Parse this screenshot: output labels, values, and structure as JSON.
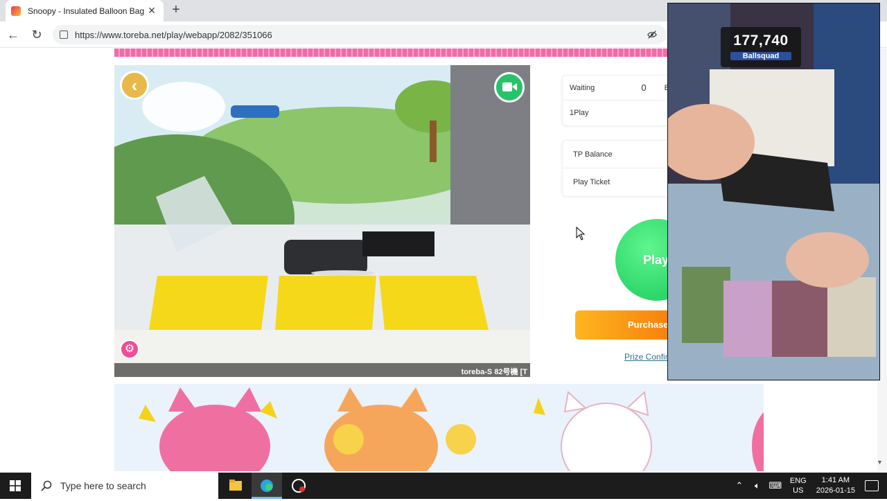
{
  "browser": {
    "tab_title": "Snoopy - Insulated Balloon Bag S",
    "url": "https://www.toreba.net/play/webapp/2082/351066"
  },
  "stream": {
    "machine_label": "toreba-S 82号機 [T"
  },
  "panel": {
    "waiting_label": "Waiting",
    "waiting_value": "0",
    "waiting_extra": "B",
    "one_play_label": "1Play",
    "tp_balance_label": "TP Balance",
    "play_ticket_label": "Play Ticket",
    "play_button": "Play",
    "purchase_button": "Purchase",
    "prize_link": "Prize Confirm"
  },
  "pip": {
    "viewer_count": "177,740",
    "channel_name": "Ballsquad"
  },
  "taskbar": {
    "search_placeholder": "Type here to search",
    "lang_top": "ENG",
    "lang_bottom": "US",
    "time": "1:41 AM",
    "date": "2026-01-15"
  },
  "colors": {
    "pink_accent": "#f26ba8",
    "play_green": "#17c95a",
    "purchase_orange": "#f5780c"
  }
}
